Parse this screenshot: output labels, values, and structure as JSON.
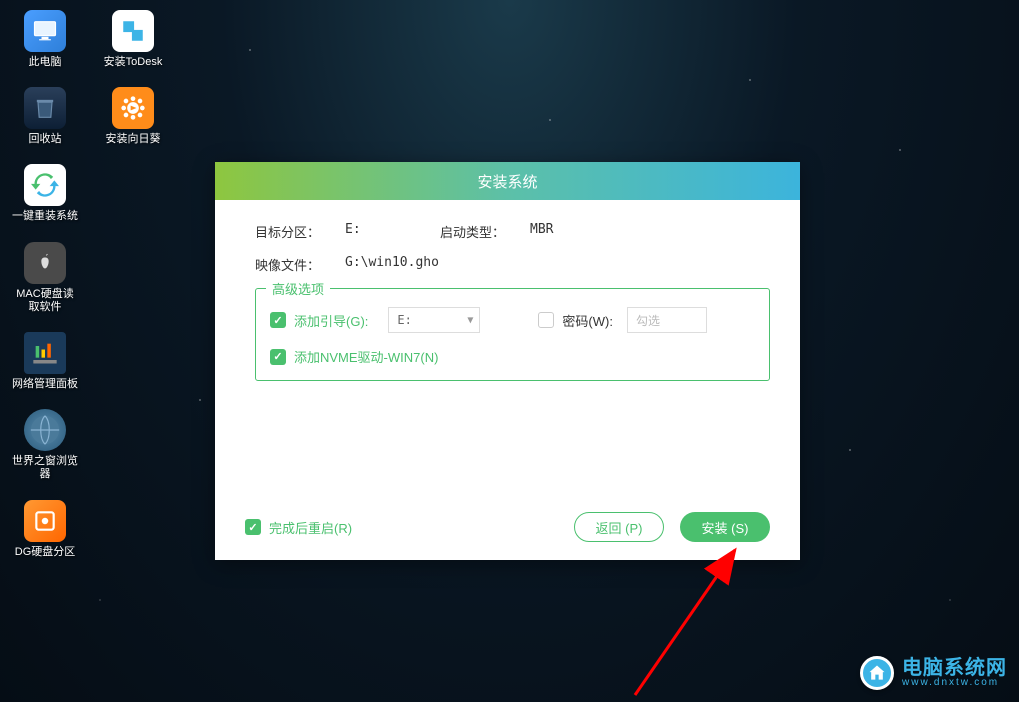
{
  "desktop": {
    "icons": [
      {
        "label": "此电脑",
        "name": "this-pc"
      },
      {
        "label": "安装ToDesk",
        "name": "install-todesk"
      },
      {
        "label": "回收站",
        "name": "recycle-bin"
      },
      {
        "label": "安装向日葵",
        "name": "install-sunflower"
      },
      {
        "label": "一键重装系统",
        "name": "one-click-reinstall"
      },
      {
        "label": "MAC硬盘读取软件",
        "name": "mac-disk-reader"
      },
      {
        "label": "网络管理面板",
        "name": "network-panel"
      },
      {
        "label": "世界之窗浏览器",
        "name": "theworld-browser"
      },
      {
        "label": "DG硬盘分区",
        "name": "dg-partition"
      }
    ]
  },
  "dialog": {
    "title": "安装系统",
    "target_partition_label": "目标分区：",
    "target_partition_value": "E:",
    "boot_type_label": "启动类型：",
    "boot_type_value": "MBR",
    "image_file_label": "映像文件：",
    "image_file_value": "G:\\win10.gho",
    "advanced_legend": "高级选项",
    "add_boot_label": "添加引导(G):",
    "add_boot_value": "E:",
    "password_label": "密码(W):",
    "password_placeholder": "勾选",
    "nvme_label": "添加NVME驱动-WIN7(N)",
    "restart_label": "完成后重启(R)",
    "back_button": "返回 (P)",
    "install_button": "安装 (S)"
  },
  "watermark": {
    "title": "电脑系统网",
    "url": "www.dnxtw.com"
  }
}
